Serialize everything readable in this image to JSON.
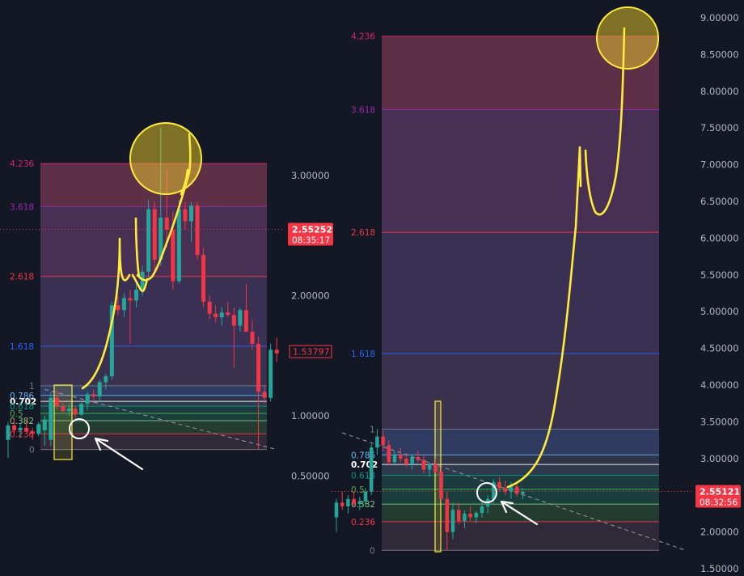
{
  "chart_data": [
    {
      "type": "candlestick-fibonacci",
      "panel": "left",
      "ylim": [
        0.35,
        3.55
      ],
      "y_axis_ticks": [
        {
          "value": 3.0,
          "label": "3.00000"
        },
        {
          "value": 2.0,
          "label": "2.00000"
        },
        {
          "value": 1.0,
          "label": "1.00000"
        },
        {
          "value": 0.5,
          "label": "0.50000"
        }
      ],
      "price_badge": {
        "label": "2.55252",
        "countdown": "08:35:17",
        "value": 2.55252,
        "color": "#f23645"
      },
      "secondary_badge": {
        "label": "1.53797",
        "value": 1.53797,
        "color": "#f23645"
      },
      "fib_levels": [
        {
          "ratio": "4.236",
          "price": 3.1,
          "color": "#d6266a"
        },
        {
          "ratio": "3.618",
          "price": 2.74,
          "color": "#9c27b0"
        },
        {
          "ratio": "2.618",
          "price": 2.16,
          "color": "#f23645"
        },
        {
          "ratio": "1.618",
          "price": 1.58,
          "color": "#2962ff"
        },
        {
          "ratio": "1",
          "price": 1.25,
          "color": "#787b86"
        },
        {
          "ratio": "0.786",
          "price": 1.17,
          "color": "#64b5f6"
        },
        {
          "ratio": "0.702",
          "price": 1.12,
          "color": "#ffffff"
        },
        {
          "ratio": "0.618",
          "price": 1.08,
          "color": "#089981"
        },
        {
          "ratio": "0.5",
          "price": 1.02,
          "color": "#4caf50"
        },
        {
          "ratio": "0.382",
          "price": 0.96,
          "color": "#81c784"
        },
        {
          "ratio": "0.236",
          "price": 0.85,
          "color": "#f23645"
        },
        {
          "ratio": "0",
          "price": 0.72,
          "color": "#787b86"
        }
      ],
      "candles": [
        [
          0.8,
          0.95,
          0.65,
          0.92
        ],
        [
          0.92,
          0.98,
          0.85,
          0.88
        ],
        [
          0.88,
          0.93,
          0.82,
          0.9
        ],
        [
          0.9,
          0.97,
          0.86,
          0.87
        ],
        [
          0.87,
          0.9,
          0.8,
          0.85
        ],
        [
          0.85,
          0.95,
          0.83,
          0.93
        ],
        [
          0.88,
          1.0,
          0.75,
          0.97
        ],
        [
          0.8,
          1.2,
          0.75,
          1.15
        ],
        [
          1.15,
          1.22,
          1.05,
          1.08
        ],
        [
          1.08,
          1.12,
          1.02,
          1.04
        ],
        [
          1.04,
          1.1,
          1.0,
          1.06
        ],
        [
          1.06,
          1.08,
          0.98,
          1.01
        ],
        [
          1.01,
          1.12,
          1.0,
          1.1
        ],
        [
          1.1,
          1.2,
          1.05,
          1.18
        ],
        [
          1.18,
          1.22,
          1.1,
          1.16
        ],
        [
          1.16,
          1.3,
          1.12,
          1.28
        ],
        [
          1.28,
          1.35,
          1.22,
          1.33
        ],
        [
          1.33,
          1.95,
          1.3,
          1.92
        ],
        [
          1.92,
          2.0,
          1.84,
          1.88
        ],
        [
          1.88,
          2.02,
          1.82,
          1.98
        ],
        [
          1.98,
          2.05,
          1.6,
          1.96
        ],
        [
          1.96,
          2.1,
          1.9,
          2.05
        ],
        [
          2.05,
          2.25,
          2.0,
          2.2
        ],
        [
          2.2,
          2.8,
          2.15,
          2.72
        ],
        [
          2.72,
          2.78,
          2.2,
          2.3
        ],
        [
          2.3,
          3.4,
          2.25,
          2.65
        ],
        [
          2.65,
          3.05,
          2.4,
          2.55
        ],
        [
          2.55,
          2.7,
          2.05,
          2.12
        ],
        [
          2.12,
          2.8,
          2.1,
          2.72
        ],
        [
          2.72,
          2.78,
          2.55,
          2.62
        ],
        [
          2.62,
          2.78,
          2.45,
          2.75
        ],
        [
          2.75,
          2.78,
          2.3,
          2.34
        ],
        [
          2.34,
          2.4,
          1.9,
          1.95
        ],
        [
          1.95,
          2.0,
          1.8,
          1.85
        ],
        [
          1.85,
          1.92,
          1.78,
          1.82
        ],
        [
          1.82,
          1.9,
          1.75,
          1.86
        ],
        [
          1.86,
          1.95,
          1.82,
          1.84
        ],
        [
          1.84,
          1.9,
          1.4,
          1.75
        ],
        [
          1.75,
          1.9,
          1.7,
          1.88
        ],
        [
          1.88,
          2.1,
          1.8,
          1.7
        ],
        [
          1.7,
          1.8,
          1.55,
          1.6
        ],
        [
          1.6,
          1.66,
          0.72,
          1.2
        ],
        [
          1.2,
          1.26,
          1.1,
          1.15
        ],
        [
          1.15,
          1.6,
          1.12,
          1.55
        ],
        [
          1.55,
          1.65,
          1.45,
          1.52
        ]
      ],
      "trendline": {
        "from": [
          6,
          1.22
        ],
        "to": [
          44,
          0.72
        ],
        "style": "dashed"
      }
    },
    {
      "type": "candlestick-fibonacci",
      "panel": "right",
      "ylim": [
        1.5,
        9.1
      ],
      "y_axis_ticks": [
        {
          "value": 9.0,
          "label": "9.00000"
        },
        {
          "value": 8.5,
          "label": "8.50000"
        },
        {
          "value": 8.0,
          "label": "8.00000"
        },
        {
          "value": 7.5,
          "label": "7.50000"
        },
        {
          "value": 7.0,
          "label": "7.00000"
        },
        {
          "value": 6.5,
          "label": "6.50000"
        },
        {
          "value": 6.0,
          "label": "6.00000"
        },
        {
          "value": 5.5,
          "label": "5.50000"
        },
        {
          "value": 5.0,
          "label": "5.00000"
        },
        {
          "value": 4.5,
          "label": "4.50000"
        },
        {
          "value": 4.0,
          "label": "4.00000"
        },
        {
          "value": 3.5,
          "label": "3.50000"
        },
        {
          "value": 3.0,
          "label": "3.00000"
        },
        {
          "value": 2.5,
          "label": "2.50000"
        },
        {
          "value": 2.0,
          "label": "2.00000"
        },
        {
          "value": 1.5,
          "label": "1.50000"
        }
      ],
      "price_badge": {
        "label": "2.55121",
        "countdown": "08:32:56",
        "value": 2.55121,
        "color": "#f23645"
      },
      "fib_levels": [
        {
          "ratio": "4.236",
          "price": 8.75,
          "color": "#d6266a"
        },
        {
          "ratio": "3.618",
          "price": 7.75,
          "color": "#9c27b0"
        },
        {
          "ratio": "2.618",
          "price": 6.08,
          "color": "#f23645"
        },
        {
          "ratio": "1.618",
          "price": 4.43,
          "color": "#2962ff"
        },
        {
          "ratio": "1",
          "price": 3.4,
          "color": "#787b86"
        },
        {
          "ratio": "0.786",
          "price": 3.05,
          "color": "#64b5f6"
        },
        {
          "ratio": "0.702",
          "price": 2.92,
          "color": "#ffffff"
        },
        {
          "ratio": "0.618",
          "price": 2.77,
          "color": "#089981"
        },
        {
          "ratio": "0.5",
          "price": 2.58,
          "color": "#4caf50"
        },
        {
          "ratio": "0.382",
          "price": 2.38,
          "color": "#81c784"
        },
        {
          "ratio": "0.236",
          "price": 2.14,
          "color": "#f23645"
        },
        {
          "ratio": "0",
          "price": 1.75,
          "color": "#787b86"
        }
      ],
      "candles": [
        [
          2.2,
          2.45,
          2.0,
          2.4
        ],
        [
          2.4,
          2.55,
          2.3,
          2.35
        ],
        [
          2.35,
          2.5,
          2.25,
          2.45
        ],
        [
          2.45,
          2.55,
          2.35,
          2.38
        ],
        [
          2.38,
          2.48,
          2.3,
          2.42
        ],
        [
          2.42,
          2.6,
          2.35,
          2.55
        ],
        [
          2.55,
          3.2,
          2.5,
          3.15
        ],
        [
          3.15,
          3.4,
          3.05,
          3.3
        ],
        [
          3.3,
          3.38,
          3.1,
          3.18
        ],
        [
          3.18,
          3.25,
          2.9,
          2.95
        ],
        [
          2.95,
          3.1,
          2.9,
          3.05
        ],
        [
          3.05,
          3.15,
          2.95,
          3.0
        ],
        [
          3.0,
          3.08,
          2.88,
          2.92
        ],
        [
          2.92,
          3.05,
          2.85,
          3.02
        ],
        [
          3.02,
          3.1,
          2.95,
          2.98
        ],
        [
          2.98,
          3.04,
          2.8,
          2.85
        ],
        [
          2.85,
          2.95,
          2.75,
          2.92
        ],
        [
          2.92,
          3.0,
          2.8,
          2.82
        ],
        [
          2.82,
          2.9,
          2.4,
          2.45
        ],
        [
          2.45,
          2.55,
          1.75,
          2.0
        ],
        [
          2.0,
          2.4,
          1.9,
          2.3
        ],
        [
          2.3,
          2.4,
          2.1,
          2.15
        ],
        [
          2.15,
          2.3,
          2.05,
          2.25
        ],
        [
          2.25,
          2.35,
          2.15,
          2.2
        ],
        [
          2.2,
          2.28,
          2.12,
          2.26
        ],
        [
          2.26,
          2.4,
          2.2,
          2.35
        ],
        [
          2.35,
          2.5,
          2.25,
          2.45
        ],
        [
          2.45,
          2.72,
          2.4,
          2.68
        ],
        [
          2.68,
          2.75,
          2.55,
          2.6
        ],
        [
          2.6,
          2.7,
          2.5,
          2.55
        ],
        [
          2.55,
          2.68,
          2.45,
          2.62
        ],
        [
          2.62,
          2.66,
          2.48,
          2.52
        ],
        [
          2.52,
          2.6,
          2.45,
          2.55
        ]
      ],
      "trendline": {
        "from": [
          1,
          3.35
        ],
        "to": [
          60,
          1.75
        ],
        "style": "dashed"
      }
    }
  ]
}
